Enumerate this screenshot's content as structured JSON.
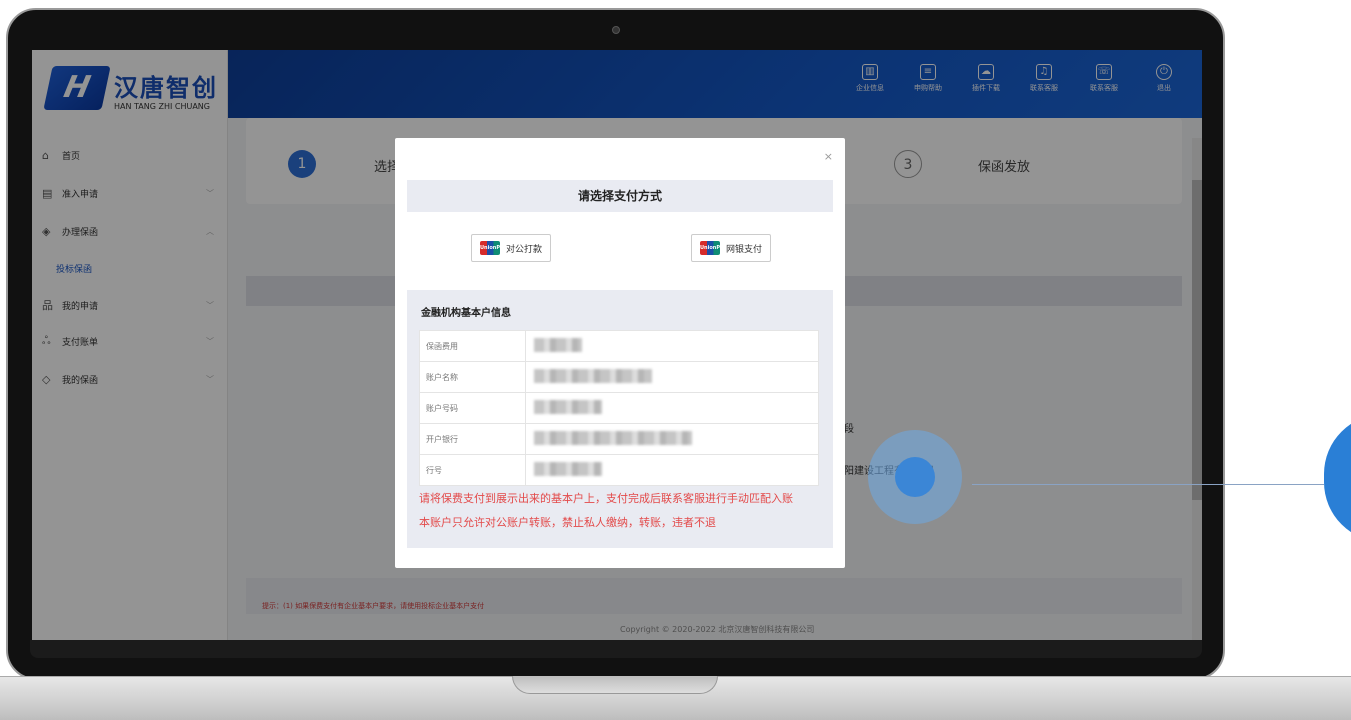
{
  "logo": {
    "cn": "汉唐智创",
    "en": "HAN TANG ZHI CHUANG",
    "mark": "H"
  },
  "header": {
    "buttons": [
      {
        "label": "企业信息",
        "icon": "building-icon"
      },
      {
        "label": "申购帮助",
        "icon": "document-icon"
      },
      {
        "label": "插件下载",
        "icon": "cloud-download-icon"
      },
      {
        "label": "联系客服",
        "icon": "bell-icon"
      },
      {
        "label": "联系客服",
        "icon": "phone-icon"
      },
      {
        "label": "退出",
        "icon": "power-icon"
      }
    ]
  },
  "sidebar": {
    "items": [
      {
        "label": "首页",
        "icon": "home-icon"
      },
      {
        "label": "准入申请",
        "icon": "form-icon"
      },
      {
        "label": "办理保函",
        "icon": "handle-icon"
      },
      {
        "label": "我的申请",
        "icon": "tree-icon"
      },
      {
        "label": "支付账单",
        "icon": "users-icon"
      },
      {
        "label": "我的保函",
        "icon": "layers-icon"
      }
    ],
    "sub_active": "投标保函"
  },
  "steps": {
    "step1_num": "1",
    "step1_text": "选择",
    "step3_num": "3",
    "step3_text": "保函发放"
  },
  "background": {
    "fragment1": "段",
    "fragment2": "阳建设工程有限公司",
    "tip": "提示：(1) 如果保费支付有企业基本户要求，请使用投标企业基本户支付",
    "copyright": "Copyright © 2020-2022 北京汉唐智创科技有限公司"
  },
  "modal": {
    "close": "×",
    "title": "请选择支付方式",
    "pay_options": [
      {
        "label": "对公打款",
        "icon": "unionpay-icon"
      },
      {
        "label": "网银支付",
        "icon": "unionpay-icon"
      }
    ],
    "unionpay_text": "UnionPay",
    "bank_title": "金融机构基本户信息",
    "rows": [
      {
        "label": "保函费用"
      },
      {
        "label": "账户名称"
      },
      {
        "label": "账户号码"
      },
      {
        "label": "开户银行"
      },
      {
        "label": "行号"
      }
    ],
    "warning1": "请将保费支付到展示出来的基本户上，支付完成后联系客服进行手动匹配入账",
    "warning2": "本账户只允许对公账户转账，禁止私人缴纳，转账，违者不退"
  }
}
